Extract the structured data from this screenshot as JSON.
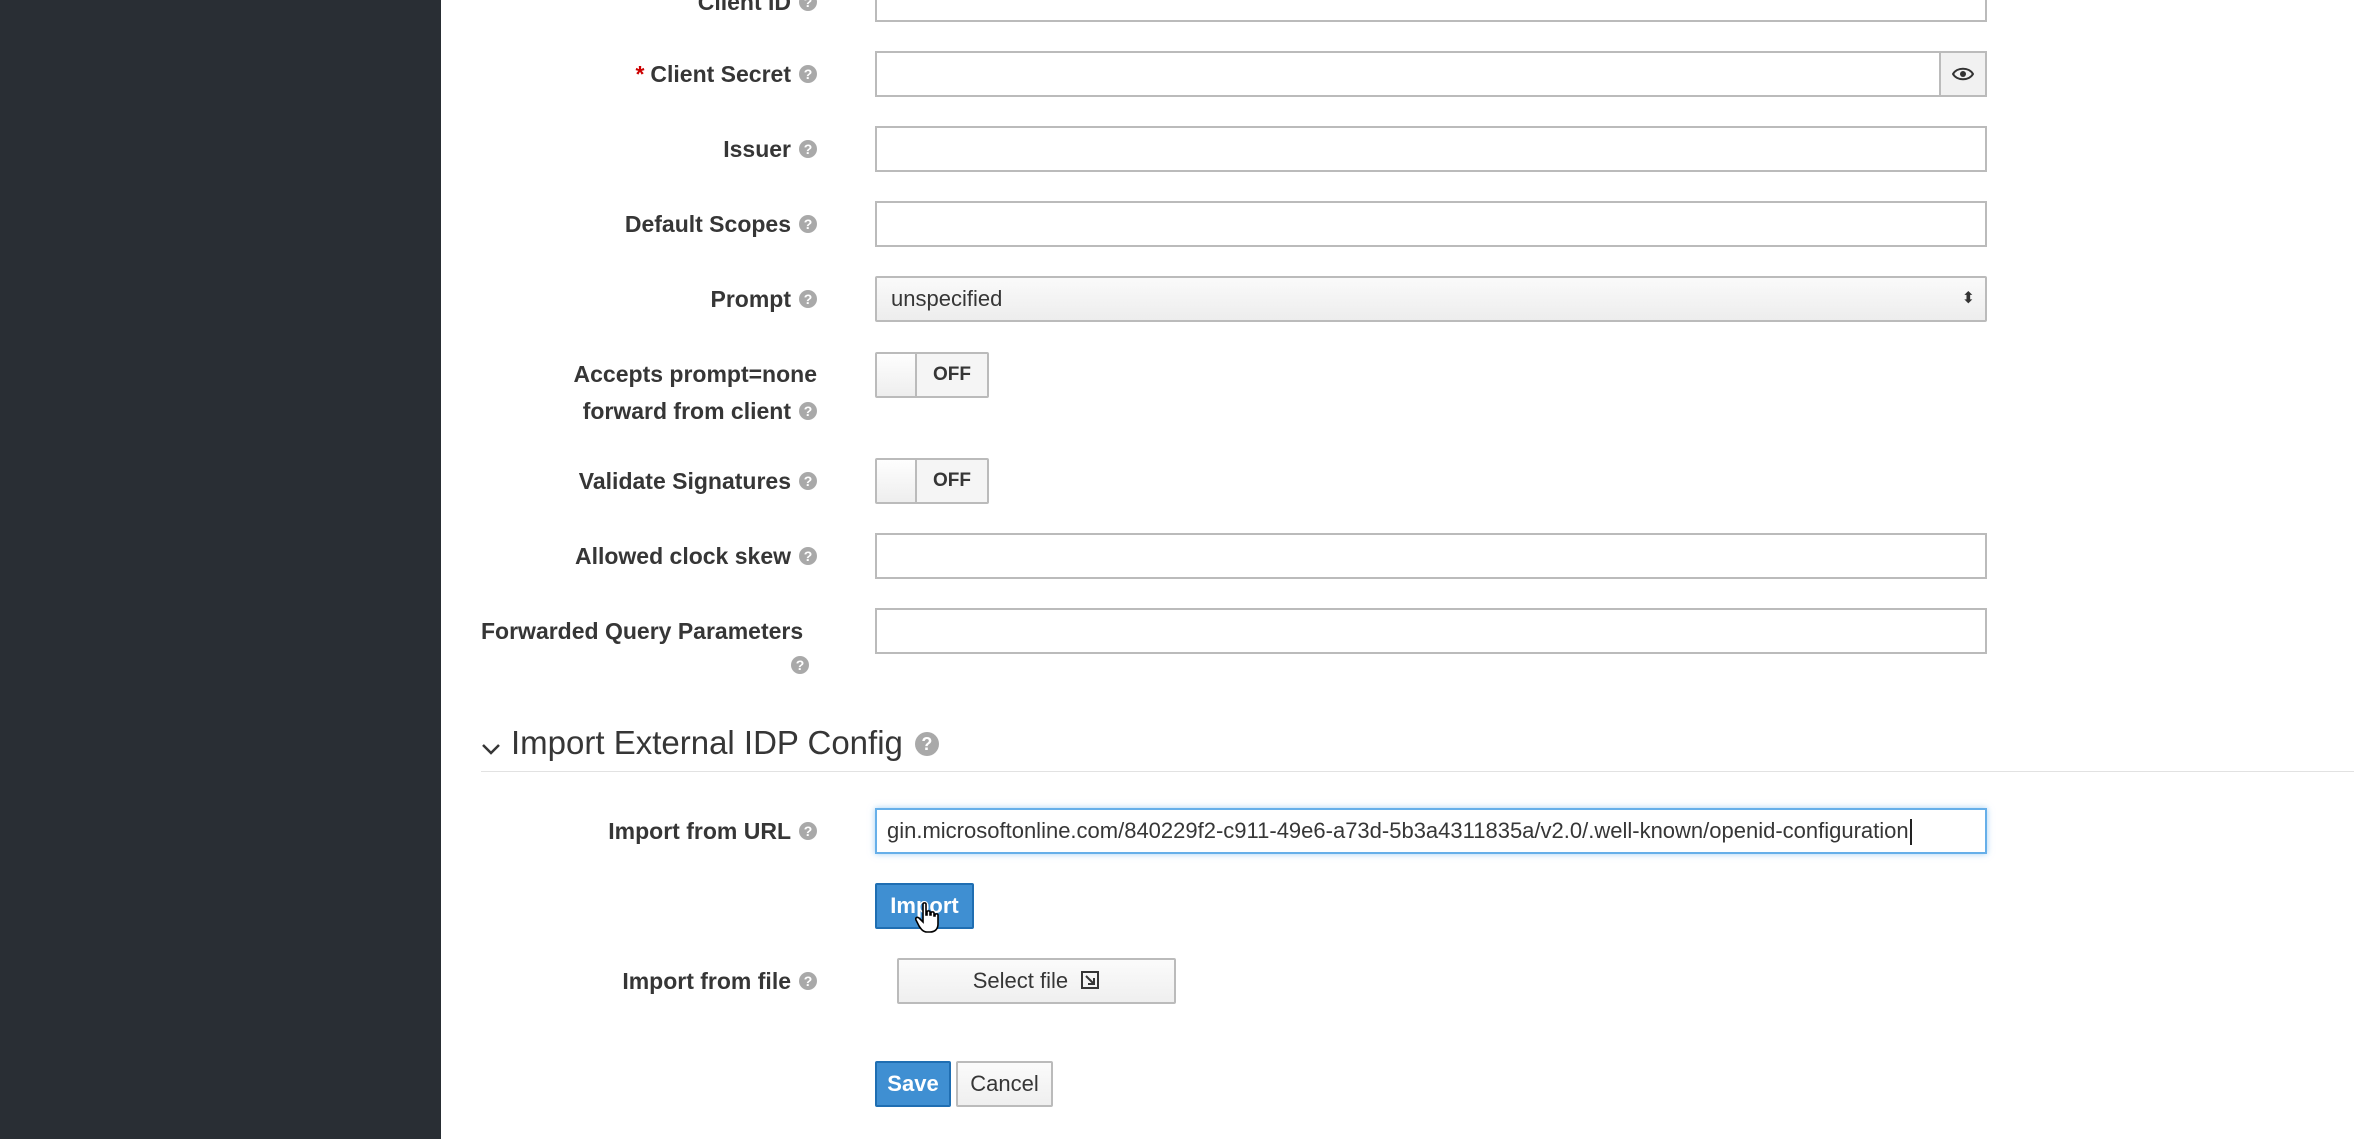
{
  "form": {
    "client_id": {
      "label": "Client ID",
      "value": ""
    },
    "client_secret": {
      "required_mark": "*",
      "label": "Client Secret",
      "value": ""
    },
    "issuer": {
      "label": "Issuer",
      "value": ""
    },
    "default_scopes": {
      "label": "Default Scopes",
      "value": ""
    },
    "prompt": {
      "label": "Prompt",
      "value": "unspecified"
    },
    "accepts_prompt_none": {
      "label_line1": "Accepts prompt=none",
      "label_line2": "forward from client",
      "state": "OFF"
    },
    "validate_signatures": {
      "label": "Validate Signatures",
      "state": "OFF"
    },
    "allowed_clock_skew": {
      "label": "Allowed clock skew",
      "value": ""
    },
    "forwarded_query_parameters": {
      "label": "Forwarded Query Parameters",
      "value": ""
    }
  },
  "import_section": {
    "title": "Import External IDP Config",
    "from_url": {
      "label": "Import from URL",
      "value": "gin.microsoftonline.com/840229f2-c911-49e6-a73d-5b3a4311835a/v2.0/.well-known/openid-configuration"
    },
    "import_button": "Import",
    "from_file": {
      "label": "Import from file",
      "button": "Select file"
    }
  },
  "actions": {
    "save": "Save",
    "cancel": "Cancel"
  },
  "help_glyph": "?",
  "colors": {
    "sidebar": "#292e34",
    "primary": "#3f8fd2",
    "required": "#cc0000"
  },
  "icons": [
    "help-icon",
    "eye-icon",
    "select-caret-icon",
    "chevron-down-icon",
    "file-import-icon",
    "hand-cursor-icon"
  ]
}
